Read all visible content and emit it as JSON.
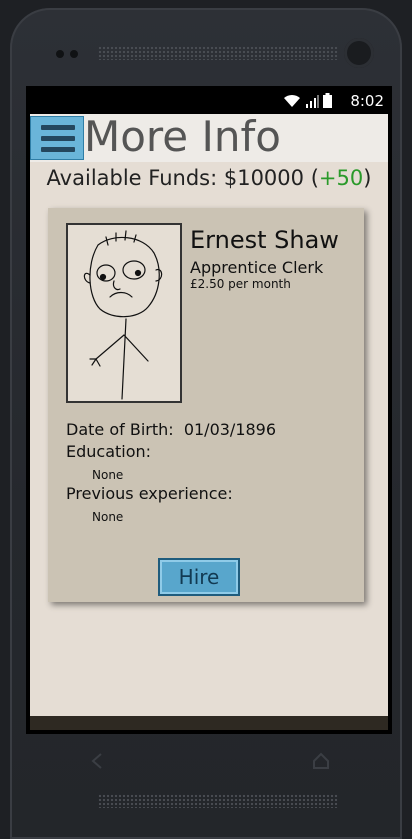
{
  "status": {
    "time": "8:02"
  },
  "header": {
    "title": "More Info"
  },
  "funds": {
    "label": "Available Funds: $10000",
    "open_paren": "(",
    "delta": "+50",
    "close_paren": ")"
  },
  "candidate": {
    "name": "Ernest Shaw",
    "role": "Apprentice Clerk",
    "pay": "£2.50 per month",
    "dob_label": "Date of Birth:",
    "dob_value": "01/03/1896",
    "education_label": "Education:",
    "education_value": "None",
    "experience_label": "Previous experience:",
    "experience_value": "None"
  },
  "actions": {
    "hire_label": "Hire"
  },
  "colors": {
    "accent": "#58a6cc",
    "delta_positive": "#2a9a2a",
    "card_bg": "#cbc3b4",
    "app_bg": "#e5ddd4"
  }
}
